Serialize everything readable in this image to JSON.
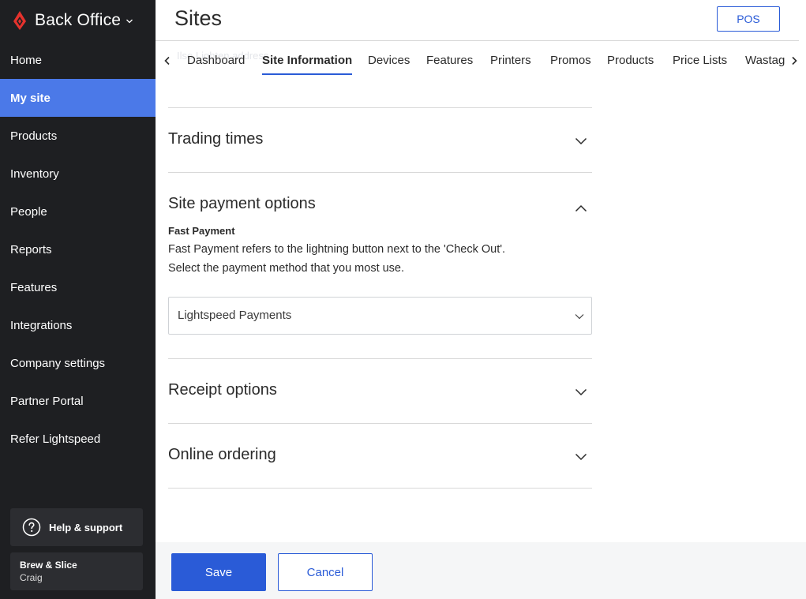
{
  "app": {
    "name": "Back Office",
    "logo_icon": "flame-logo-icon",
    "brand_color": "#e5322d"
  },
  "sidebar": {
    "items": [
      {
        "label": "Home",
        "active": false
      },
      {
        "label": "My site",
        "active": true
      },
      {
        "label": "Products",
        "active": false
      },
      {
        "label": "Inventory",
        "active": false
      },
      {
        "label": "People",
        "active": false
      },
      {
        "label": "Reports",
        "active": false
      },
      {
        "label": "Features",
        "active": false
      },
      {
        "label": "Integrations",
        "active": false
      },
      {
        "label": "Company settings",
        "active": false
      },
      {
        "label": "Partner Portal",
        "active": false
      },
      {
        "label": "Refer Lightspeed",
        "active": false
      }
    ],
    "help_label": "Help & support",
    "account": {
      "name": "Brew & Slice",
      "user": "Craig"
    }
  },
  "header": {
    "title": "Sites",
    "pos_label": "POS"
  },
  "tabs": {
    "ghost_text": "Ilse Lighten address",
    "items": [
      {
        "label": "Dashboard",
        "active": false
      },
      {
        "label": "Site Information",
        "active": true
      },
      {
        "label": "Devices",
        "active": false
      },
      {
        "label": "Features",
        "active": false
      },
      {
        "label": "Printers",
        "active": false
      },
      {
        "label": "Promos",
        "active": false
      },
      {
        "label": "Products",
        "active": false
      },
      {
        "label": "Price Lists",
        "active": false
      },
      {
        "label": "Wastage",
        "active": false
      }
    ]
  },
  "sections": {
    "trading_times": {
      "title": "Trading times",
      "expanded": false
    },
    "site_payment": {
      "title": "Site payment options",
      "expanded": true,
      "fast_payment_title": "Fast Payment",
      "fast_payment_desc_1": "Fast Payment refers to the lightning button next to the 'Check Out'.",
      "fast_payment_desc_2": "Select the payment method that you most use.",
      "selected_method": "Lightspeed Payments"
    },
    "receipt_options": {
      "title": "Receipt options",
      "expanded": false
    },
    "online_ordering": {
      "title": "Online ordering",
      "expanded": false
    }
  },
  "footer": {
    "save_label": "Save",
    "cancel_label": "Cancel"
  },
  "colors": {
    "sidebar_bg": "#1e1f22",
    "active_nav": "#4b79e8",
    "primary": "#2a5bd7"
  }
}
